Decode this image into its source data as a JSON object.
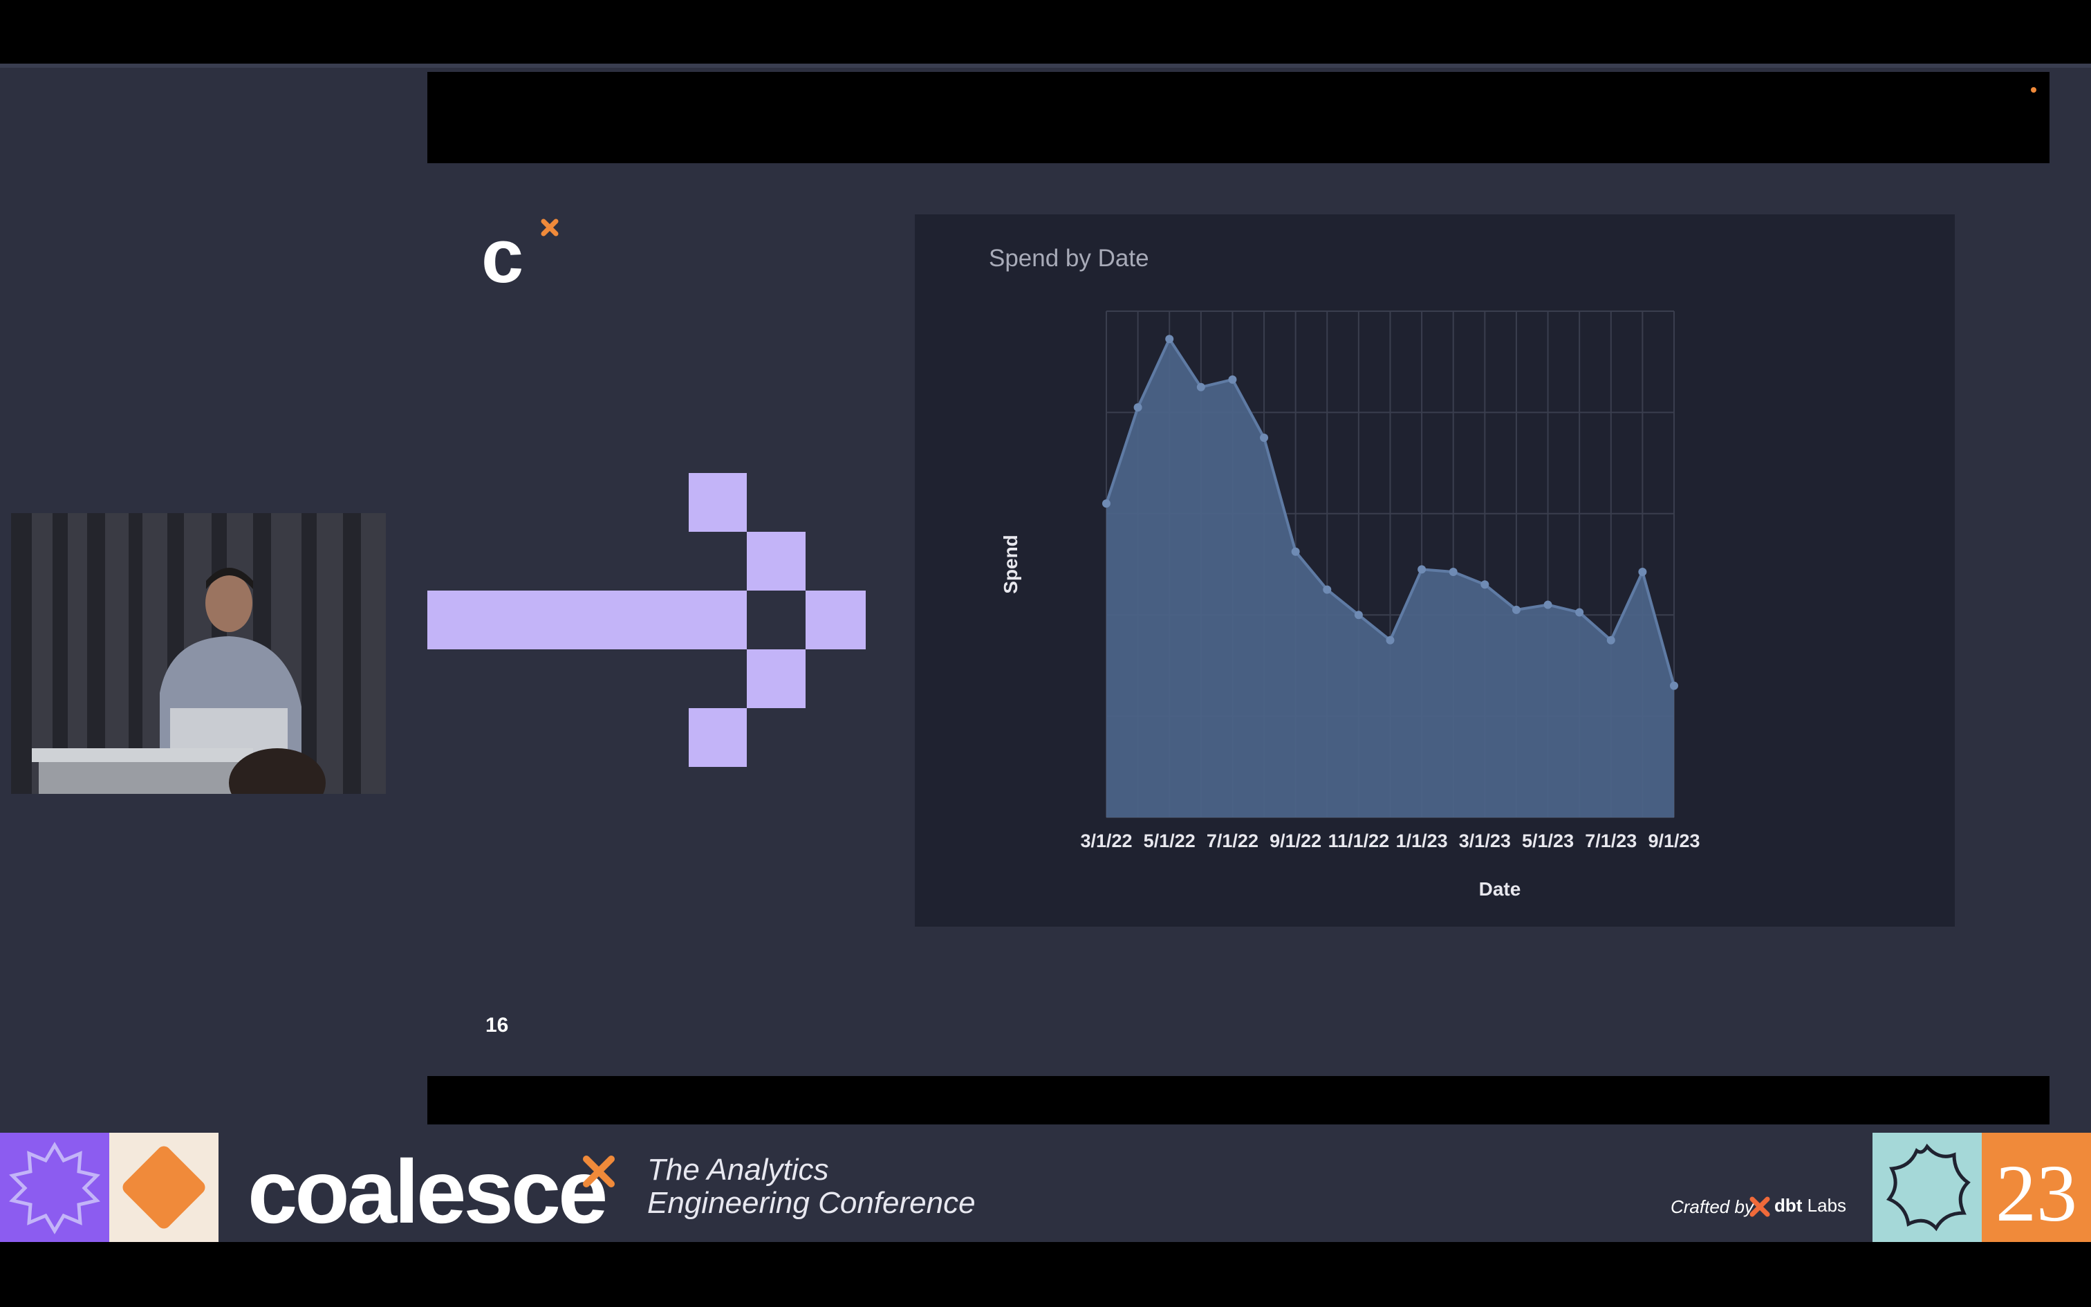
{
  "slide": {
    "page_number": "16",
    "logo_letter": "c"
  },
  "chart": {
    "title": "Spend by Date",
    "xlabel": "Date",
    "ylabel": "Spend"
  },
  "chart_data": {
    "type": "area",
    "title": "Spend by Date",
    "xlabel": "Date",
    "ylabel": "Spend",
    "x_tick_labels": [
      "3/1/22",
      "5/1/22",
      "7/1/22",
      "9/1/22",
      "11/1/22",
      "1/1/23",
      "3/1/23",
      "5/1/23",
      "7/1/23",
      "9/1/23"
    ],
    "x": [
      "3/1/22",
      "4/1/22",
      "5/1/22",
      "6/1/22",
      "7/1/22",
      "8/1/22",
      "9/1/22",
      "10/1/22",
      "11/1/22",
      "12/1/22",
      "1/1/23",
      "2/1/23",
      "3/1/23",
      "4/1/23",
      "5/1/23",
      "6/1/23",
      "7/1/23",
      "8/1/23",
      "9/1/23"
    ],
    "values": [
      62,
      81,
      94.5,
      85,
      86.5,
      75,
      52.5,
      45,
      40,
      35,
      49,
      48.5,
      46,
      41,
      42,
      40.5,
      35,
      48.5,
      26
    ],
    "ylim": [
      0,
      100
    ],
    "y_tick_labels_shown": false,
    "grid": true,
    "color": "#4b6387"
  },
  "footer": {
    "brand": "coalesce",
    "tagline_line1": "The Analytics",
    "tagline_line2": "Engineering Conference",
    "crafted_by": "Crafted by",
    "crafted_brand": "dbt",
    "crafted_brand_suffix": "Labs",
    "year": "23"
  },
  "colors": {
    "background": "#2d3040",
    "panel": "#1f2230",
    "accent_lavender": "#c3b4f8",
    "accent_orange": "#f08a3a",
    "accent_purple": "#8c5cf0",
    "accent_teal": "#a5d8d8"
  }
}
